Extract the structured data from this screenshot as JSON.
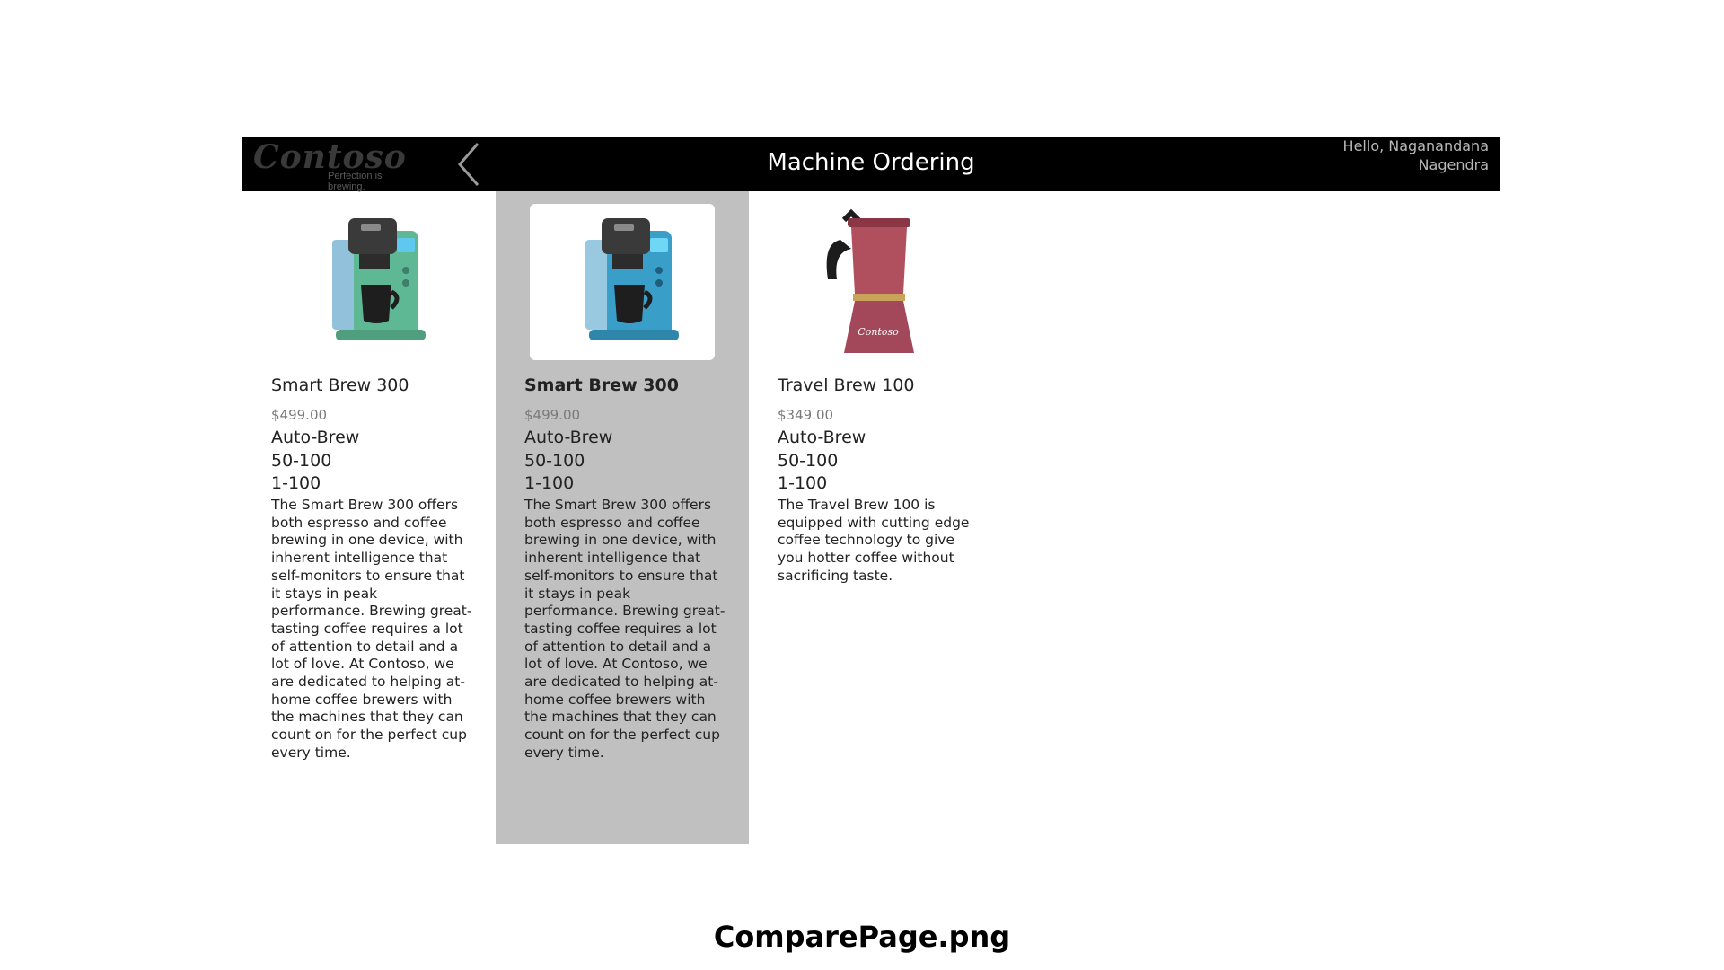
{
  "header": {
    "logo_text": "Contoso",
    "logo_tagline": "Perfection is brewing.",
    "title": "Machine Ordering",
    "greeting_line1": "Hello, Naganandana",
    "greeting_line2": "Nagendra"
  },
  "products": [
    {
      "name": "Smart Brew 300",
      "price": "$499.00",
      "type": "Auto-Brew",
      "spec1": "50-100",
      "spec2": "1-100",
      "description": "The Smart Brew 300 offers both espresso and coffee brewing in one device, with inherent intelligence that self-monitors to ensure that it stays in peak performance. Brewing great-tasting coffee requires a lot of attention to detail and a lot of love. At Contoso, we are dedicated to helping at-home coffee brewers with the machines that they can count on for the perfect cup every time.",
      "image_icon": "green-coffee-machine-image",
      "selected": false
    },
    {
      "name": "Smart Brew 300",
      "price": "$499.00",
      "type": "Auto-Brew",
      "spec1": "50-100",
      "spec2": "1-100",
      "description": "The Smart Brew 300 offers both espresso and coffee brewing in one device, with inherent intelligence that self-monitors to ensure that it stays in peak performance. Brewing great-tasting coffee requires a lot of attention to detail and a lot of love. At Contoso, we are dedicated to helping at-home coffee brewers with the machines that they can count on for the perfect cup every time.",
      "image_icon": "blue-coffee-machine-image",
      "selected": true
    },
    {
      "name": "Travel Brew 100",
      "price": "$349.00",
      "type": "Auto-Brew",
      "spec1": "50-100",
      "spec2": "1-100",
      "description": "The Travel Brew 100 is equipped with cutting edge coffee technology to give you hotter coffee without sacrificing taste.",
      "image_icon": "moka-pot-image",
      "image_label": "Contoso",
      "selected": false
    }
  ],
  "caption": "ComparePage.png",
  "colors": {
    "header_bg": "#000000",
    "selected_bg": "#c0c0c0",
    "machine_green": "#5fb894",
    "machine_blue": "#3a9fc8",
    "moka_pink": "#b0505e"
  }
}
